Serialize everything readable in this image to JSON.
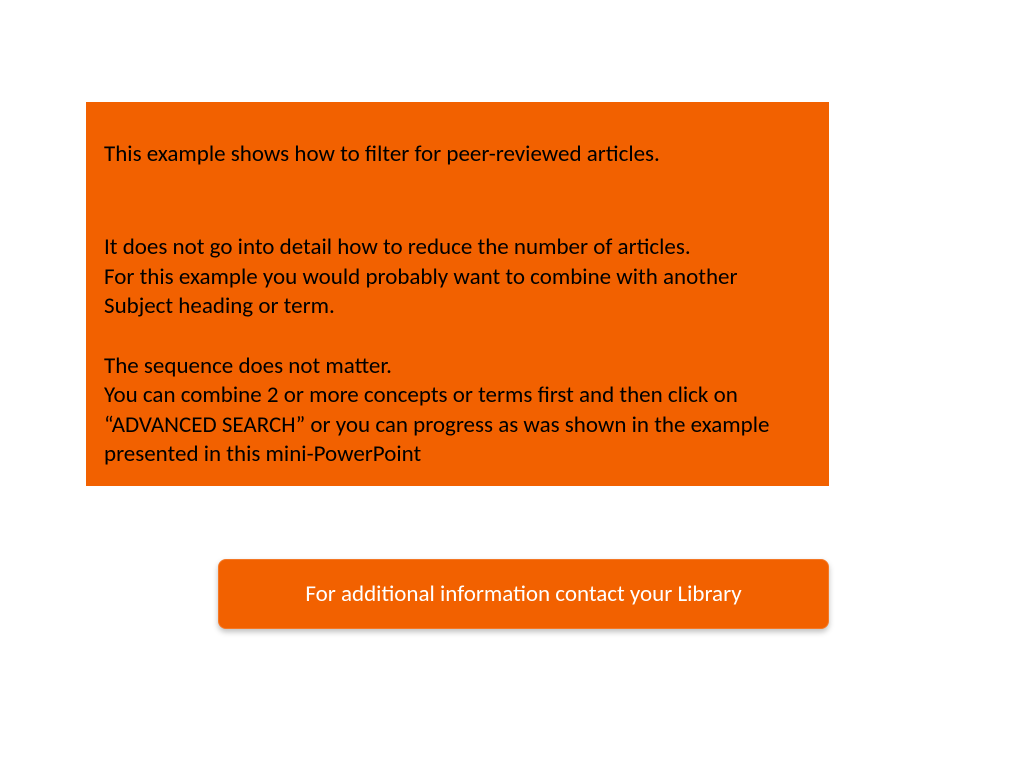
{
  "main": {
    "p1": "This example shows how to filter for peer-reviewed articles.",
    "p2_line1": "It does not go into detail how to reduce the number of articles.",
    "p2_line2": "For this example you would probably want to combine with another Subject heading or term.",
    "p3_line1": "The sequence does not matter.",
    "p3_line2": "You can combine 2 or more concepts or terms first and then click on “ADVANCED SEARCH” or you can progress as was shown in the example presented in this mini-PowerPoint"
  },
  "contact": {
    "label": "For additional information contact your Library"
  }
}
